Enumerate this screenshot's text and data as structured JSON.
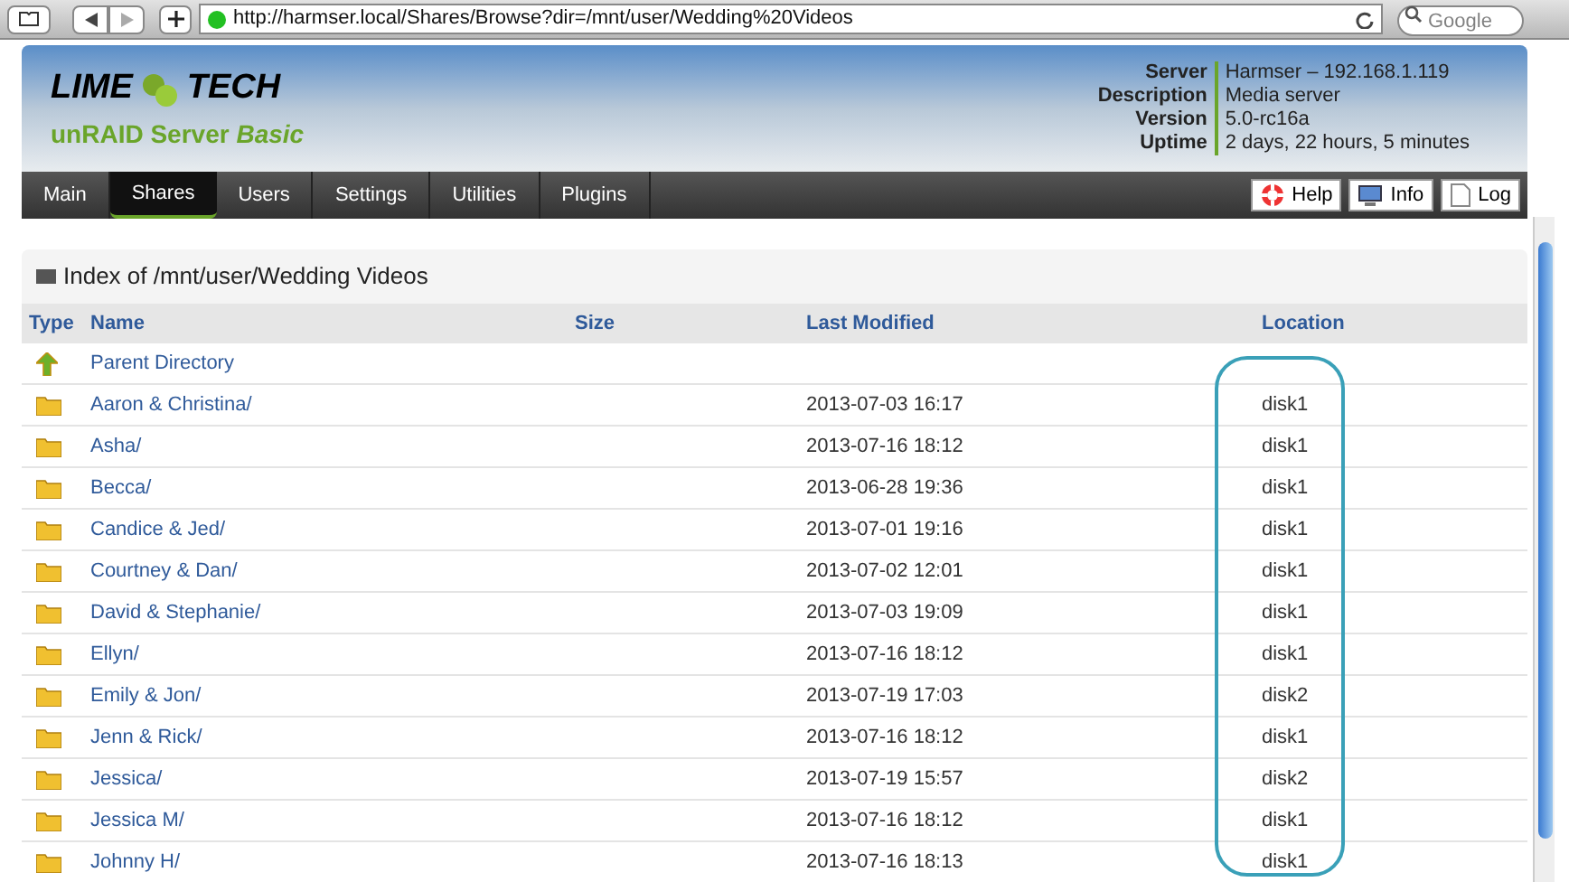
{
  "browser": {
    "url": "http://harmser.local/Shares/Browse?dir=/mnt/user/Wedding%20Videos",
    "search_placeholder": "Google"
  },
  "header": {
    "logo_left": "LIME",
    "logo_right": "TECH",
    "product": "unRAID Server",
    "edition": "Basic",
    "info": [
      {
        "label": "Server",
        "value": "Harmser – 192.168.1.119"
      },
      {
        "label": "Description",
        "value": "Media server"
      },
      {
        "label": "Version",
        "value": "5.0-rc16a"
      },
      {
        "label": "Uptime",
        "value": "2 days, 22 hours, 5 minutes"
      }
    ]
  },
  "tabs": [
    {
      "label": "Main",
      "selected": false
    },
    {
      "label": "Shares",
      "selected": true
    },
    {
      "label": "Users",
      "selected": false
    },
    {
      "label": "Settings",
      "selected": false
    },
    {
      "label": "Utilities",
      "selected": false
    },
    {
      "label": "Plugins",
      "selected": false
    }
  ],
  "actions": [
    {
      "label": "Help",
      "kind": "help"
    },
    {
      "label": "Info",
      "kind": "info"
    },
    {
      "label": "Log",
      "kind": "log"
    }
  ],
  "panel": {
    "title": "Index of /mnt/user/Wedding Videos",
    "columns": [
      "Type",
      "Name",
      "Size",
      "Last Modified",
      "Location"
    ],
    "rows": [
      {
        "kind": "parent",
        "name": "Parent Directory",
        "modified": "",
        "location": ""
      },
      {
        "kind": "folder",
        "name": "Aaron & Christina/",
        "modified": "2013-07-03 16:17",
        "location": "disk1"
      },
      {
        "kind": "folder",
        "name": "Asha/",
        "modified": "2013-07-16 18:12",
        "location": "disk1"
      },
      {
        "kind": "folder",
        "name": "Becca/",
        "modified": "2013-06-28 19:36",
        "location": "disk1"
      },
      {
        "kind": "folder",
        "name": "Candice & Jed/",
        "modified": "2013-07-01 19:16",
        "location": "disk1"
      },
      {
        "kind": "folder",
        "name": "Courtney & Dan/",
        "modified": "2013-07-02 12:01",
        "location": "disk1"
      },
      {
        "kind": "folder",
        "name": "David & Stephanie/",
        "modified": "2013-07-03 19:09",
        "location": "disk1"
      },
      {
        "kind": "folder",
        "name": "Ellyn/",
        "modified": "2013-07-16 18:12",
        "location": "disk1"
      },
      {
        "kind": "folder",
        "name": "Emily & Jon/",
        "modified": "2013-07-19 17:03",
        "location": "disk2"
      },
      {
        "kind": "folder",
        "name": "Jenn & Rick/",
        "modified": "2013-07-16 18:12",
        "location": "disk1"
      },
      {
        "kind": "folder",
        "name": "Jessica/",
        "modified": "2013-07-19 15:57",
        "location": "disk2"
      },
      {
        "kind": "folder",
        "name": "Jessica M/",
        "modified": "2013-07-16 18:12",
        "location": "disk1"
      },
      {
        "kind": "folder",
        "name": "Johnny H/",
        "modified": "2013-07-16 18:13",
        "location": "disk1"
      }
    ]
  }
}
